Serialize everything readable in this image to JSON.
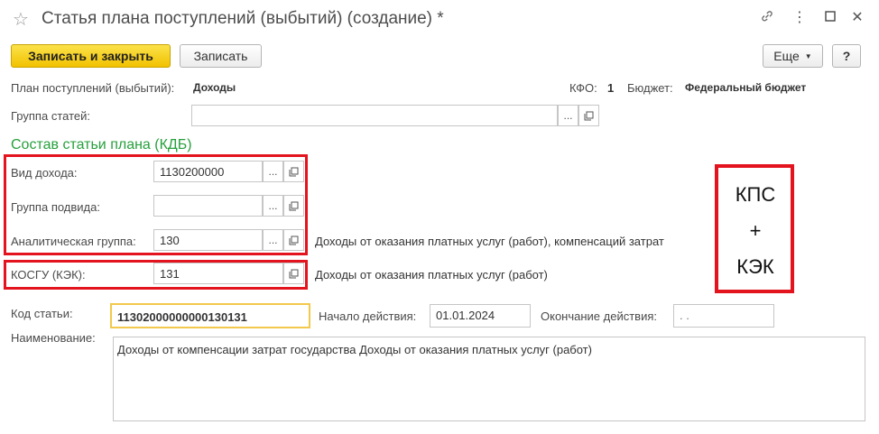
{
  "window": {
    "title": "Статья плана поступлений (выбытий) (создание) *"
  },
  "toolbar": {
    "save_close_label": "Записать и закрыть",
    "save_label": "Записать",
    "more_label": "Еще",
    "help_label": "?"
  },
  "header": {
    "plan_label": "План поступлений (выбытий):",
    "plan_value": "Доходы",
    "kfo_label": "КФО:",
    "kfo_value": "1",
    "budget_label": "Бюджет:",
    "budget_value": "Федеральный бюджет"
  },
  "group": {
    "label": "Группа статей:",
    "value": ""
  },
  "section": {
    "title": "Состав статьи плана (КДБ)"
  },
  "fields": {
    "income_type": {
      "label": "Вид дохода:",
      "value": "1130200000"
    },
    "subtype_group": {
      "label": "Группа подвида:",
      "value": ""
    },
    "analytic_group": {
      "label": "Аналитическая группа:",
      "value": "130",
      "description": "Доходы от оказания платных услуг (работ), компенсаций затрат"
    },
    "kosgu": {
      "label": "КОСГУ (КЭК):",
      "value": "131",
      "description": "Доходы от оказания платных услуг (работ)"
    }
  },
  "annotation": {
    "line1": "КПС",
    "line2": "+",
    "line3": "КЭК"
  },
  "code": {
    "label": "Код статьи:",
    "value": "11302000000000130131",
    "start_label": "Начало действия:",
    "start_value": "01.01.2024",
    "end_label": "Окончание действия:",
    "end_value": " .  ."
  },
  "name": {
    "label": "Наименование:",
    "value": "Доходы от компенсации затрат государства Доходы от оказания платных услуг (работ)"
  },
  "icons": [
    "star-icon",
    "link-icon",
    "more-vertical-icon",
    "maximize-icon",
    "close-icon",
    "open-icon"
  ]
}
